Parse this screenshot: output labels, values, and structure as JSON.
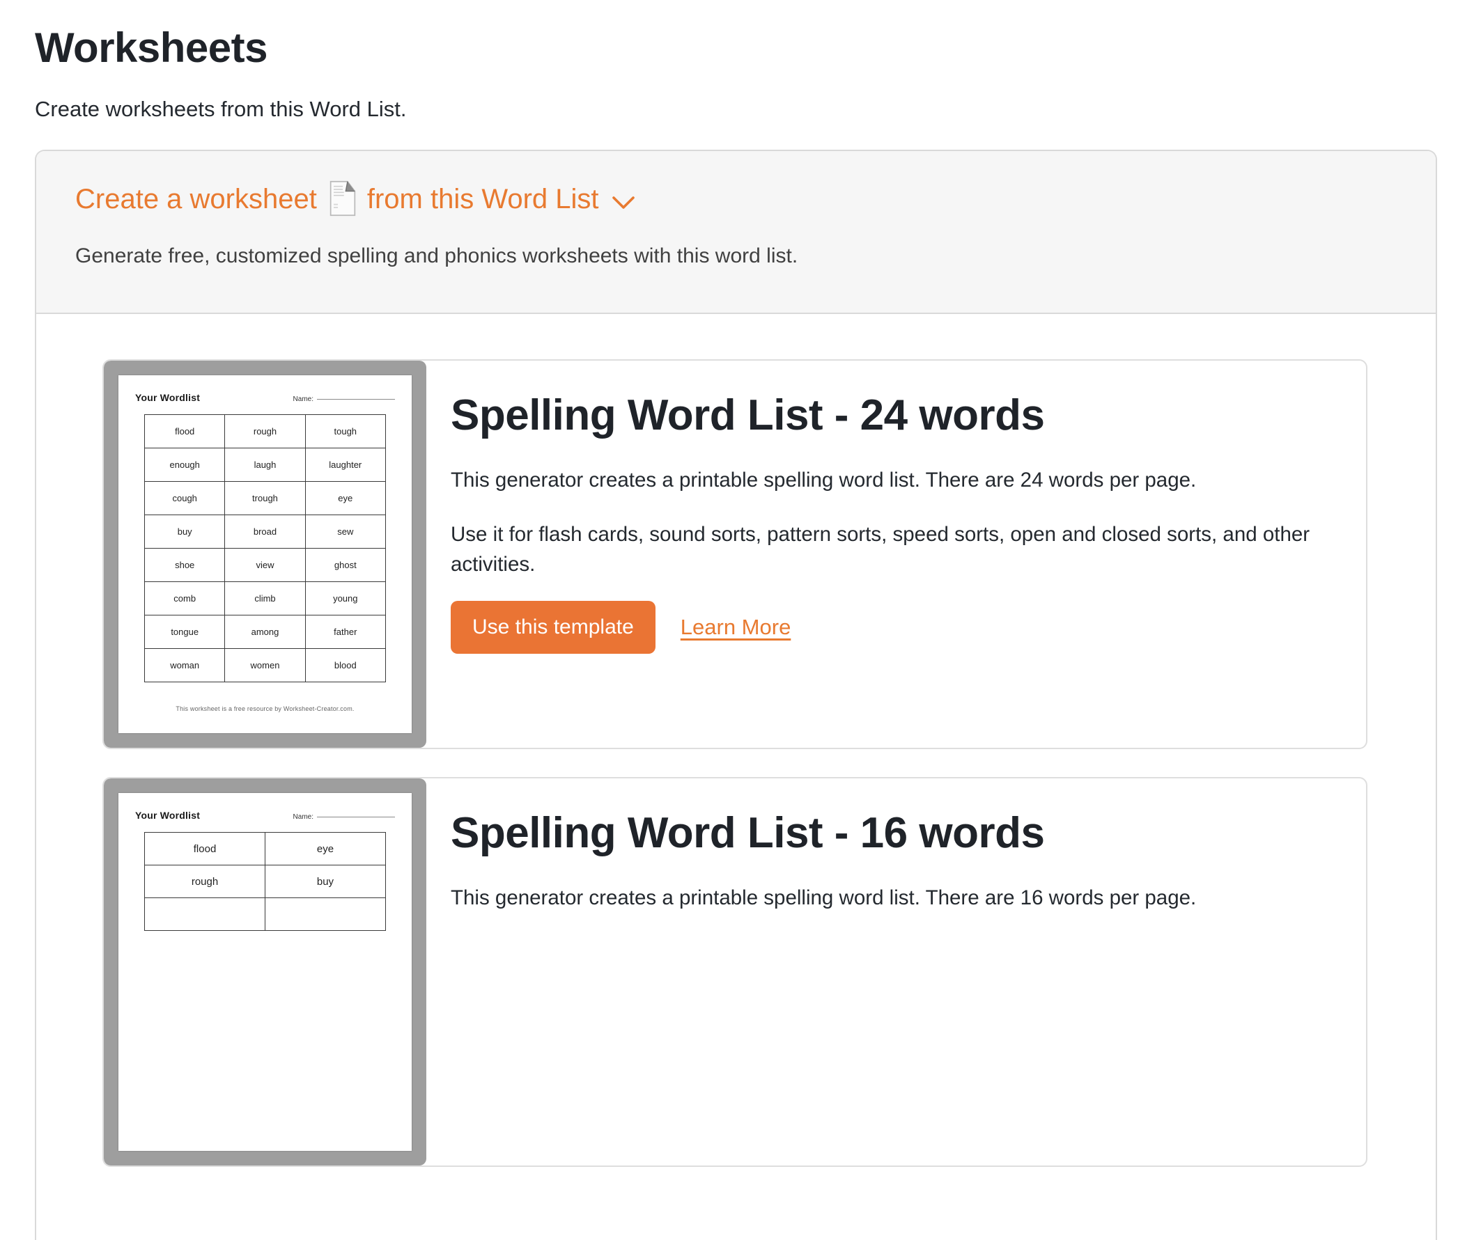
{
  "page": {
    "title": "Worksheets",
    "subtitle": "Create worksheets from this Word List."
  },
  "creator": {
    "heading_pre": "Create a worksheet",
    "heading_post": "from this Word List",
    "icons": {
      "document": "document-icon",
      "chevron": "chevron-down-icon"
    },
    "description": "Generate free, customized spelling and phonics worksheets with this word list."
  },
  "colors": {
    "accent": "#E87A30",
    "button": "#EA7434",
    "heading_text": "#1F2329",
    "body_text": "#24292F",
    "panel_bg": "#F6F6F6",
    "panel_border": "#D9D9D9",
    "card_border": "#DEDEDE",
    "preview_frame": "#9E9E9E"
  },
  "cards": [
    {
      "title": "Spelling Word List - 24 words",
      "description": "This generator creates a printable spelling word list. There are 24 words per page.",
      "usage": "Use it for flash cards, sound sorts, pattern sorts, speed sorts, open and closed sorts, and other activities.",
      "button_label": "Use this template",
      "link_label": "Learn More",
      "preview": {
        "heading": "Your Wordlist",
        "name_label": "Name:",
        "columns": 3,
        "rows": [
          [
            "flood",
            "rough",
            "tough"
          ],
          [
            "enough",
            "laugh",
            "laughter"
          ],
          [
            "cough",
            "trough",
            "eye"
          ],
          [
            "buy",
            "broad",
            "sew"
          ],
          [
            "shoe",
            "view",
            "ghost"
          ],
          [
            "comb",
            "climb",
            "young"
          ],
          [
            "tongue",
            "among",
            "father"
          ],
          [
            "woman",
            "women",
            "blood"
          ]
        ],
        "footer": "This worksheet is a free resource by Worksheet-Creator.com."
      }
    },
    {
      "title": "Spelling Word List - 16 words",
      "description": "This generator creates a printable spelling word list. There are 16 words per page.",
      "preview": {
        "heading": "Your Wordlist",
        "name_label": "Name:",
        "columns": 2,
        "rows": [
          [
            "flood",
            "eye"
          ],
          [
            "rough",
            "buy"
          ],
          [
            "",
            ""
          ]
        ]
      }
    }
  ]
}
